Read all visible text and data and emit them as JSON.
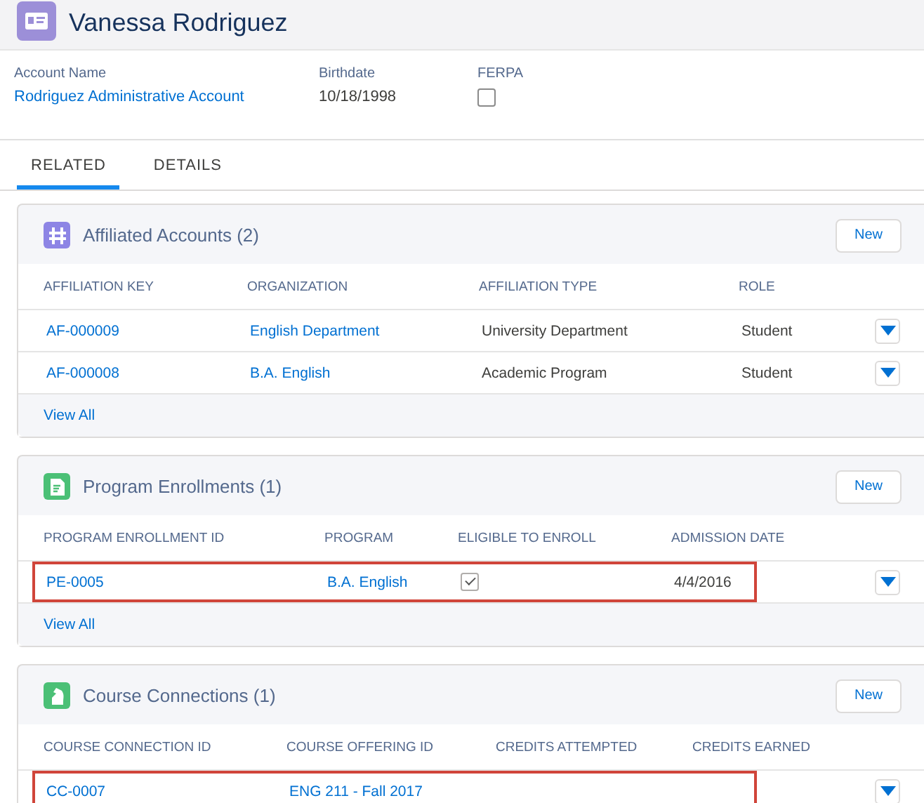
{
  "record": {
    "name": "Vanessa Rodriguez"
  },
  "fields": [
    {
      "label": "Account Name",
      "value": "Rodriguez Administrative Account",
      "kind": "link"
    },
    {
      "label": "Birthdate",
      "value": "10/18/1998",
      "kind": "text"
    },
    {
      "label": "FERPA",
      "checked": false,
      "kind": "checkbox"
    }
  ],
  "tabs": [
    {
      "label": "RELATED",
      "selected": true
    },
    {
      "label": "DETAILS",
      "selected": false
    }
  ],
  "cards": [
    {
      "title": "Affiliated Accounts (2)",
      "kind": "affiliation",
      "button": "New",
      "columns": [
        "AFFILIATION KEY",
        "ORGANIZATION",
        "AFFILIATION TYPE",
        "ROLE"
      ],
      "rows": [
        {
          "highlighted": false,
          "cells": [
            {
              "kind": "link",
              "text": "AF-000009"
            },
            {
              "kind": "link",
              "text": "English Department"
            },
            {
              "kind": "text",
              "text": "University Department"
            },
            {
              "kind": "text",
              "text": "Student"
            }
          ]
        },
        {
          "highlighted": false,
          "cells": [
            {
              "kind": "link",
              "text": "AF-000008"
            },
            {
              "kind": "link",
              "text": "B.A. English"
            },
            {
              "kind": "text",
              "text": "Academic Program"
            },
            {
              "kind": "text",
              "text": "Student"
            }
          ]
        }
      ],
      "footer": "View All"
    },
    {
      "title": "Program Enrollments (1)",
      "kind": "enrollment",
      "button": "New",
      "columns": [
        "PROGRAM ENROLLMENT ID",
        "PROGRAM",
        "ELIGIBLE TO ENROLL",
        "ADMISSION DATE"
      ],
      "rows": [
        {
          "highlighted": true,
          "cells": [
            {
              "kind": "link",
              "text": "PE-0005"
            },
            {
              "kind": "link",
              "text": "B.A. English"
            },
            {
              "kind": "checkbox",
              "checked": true
            },
            {
              "kind": "text",
              "text": "4/4/2016"
            }
          ]
        }
      ],
      "footer": "View All"
    },
    {
      "title": "Course Connections (1)",
      "kind": "course",
      "button": "New",
      "columns": [
        "COURSE CONNECTION ID",
        "COURSE OFFERING ID",
        "CREDITS ATTEMPTED",
        "CREDITS EARNED"
      ],
      "rows": [
        {
          "highlighted": true,
          "cells": [
            {
              "kind": "link",
              "text": "CC-0007"
            },
            {
              "kind": "link",
              "text": "ENG 211 - Fall 2017"
            }
          ]
        }
      ]
    }
  ]
}
